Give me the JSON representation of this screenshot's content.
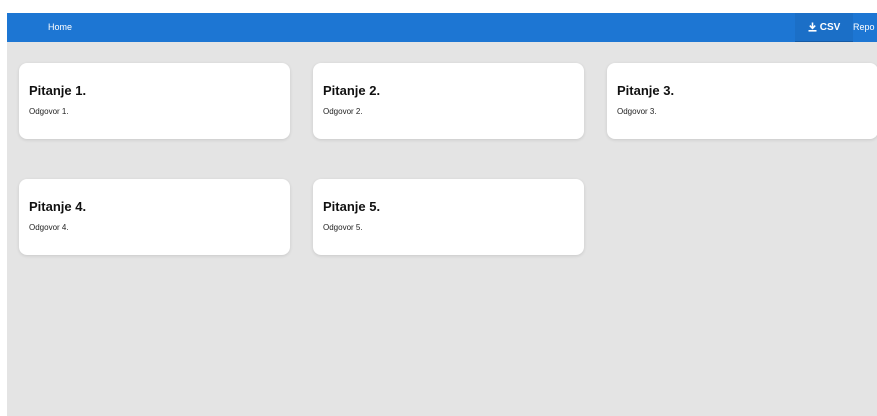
{
  "navbar": {
    "home_label": "Home",
    "csv_label": "CSV",
    "csv_icon": "download-icon",
    "reports_label": "Repo"
  },
  "cards": [
    {
      "title": "Pitanje 1.",
      "answer": "Odgovor 1."
    },
    {
      "title": "Pitanje 2.",
      "answer": "Odgovor 2."
    },
    {
      "title": "Pitanje 3.",
      "answer": "Odgovor 3."
    },
    {
      "title": "Pitanje 4.",
      "answer": "Odgovor 4."
    },
    {
      "title": "Pitanje 5.",
      "answer": "Odgovor 5."
    }
  ]
}
